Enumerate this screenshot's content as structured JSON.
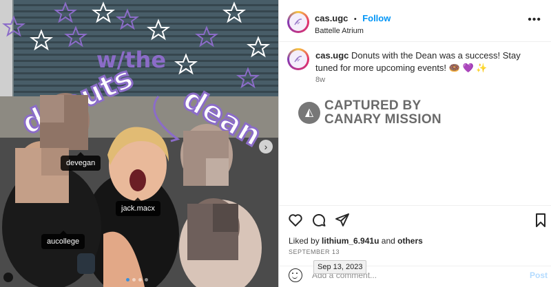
{
  "photo": {
    "overlay_text": {
      "word1": "donuts",
      "word2": "w/the",
      "word3": "dean"
    },
    "tags": [
      {
        "label": "devegan"
      },
      {
        "label": "jack.macx"
      },
      {
        "label": "aucollege"
      }
    ],
    "carousel": {
      "count": 4,
      "active_index": 0
    }
  },
  "header": {
    "username": "cas.ugc",
    "separator": "•",
    "follow_label": "Follow",
    "location": "Battelle Atrium",
    "more_icon": "more-horizontal-icon"
  },
  "caption": {
    "username": "cas.ugc",
    "text": "Donuts with the Dean was a success! Stay tuned for more upcoming events! 🍩 💜 ✨",
    "age": "8w"
  },
  "watermark": {
    "line1": "CAPTURED BY",
    "line2": "CANARY MISSION"
  },
  "actions": {
    "icons": [
      "heart-icon",
      "comment-icon",
      "share-icon",
      "bookmark-icon"
    ]
  },
  "likes": {
    "prefix": "Liked by",
    "user": "lithium_6.941u",
    "conj": "and",
    "others": "others"
  },
  "post_date": "SEPTEMBER 13",
  "tooltip": "Sep 13, 2023",
  "comment": {
    "placeholder": "Add a comment...",
    "post_label": "Post"
  },
  "colors": {
    "accent": "#0095f6",
    "overlay_purple": "#8b6cc8",
    "text": "#262626"
  }
}
